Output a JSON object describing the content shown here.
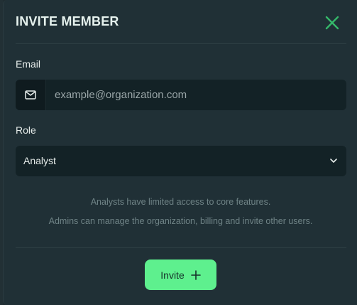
{
  "modal": {
    "title": "INVITE MEMBER",
    "close_icon": "close-icon"
  },
  "email": {
    "label": "Email",
    "placeholder": "example@organization.com",
    "value": "",
    "icon": "mail-icon"
  },
  "role": {
    "label": "Role",
    "selected": "Analyst",
    "icon": "chevron-down-icon"
  },
  "help": {
    "line1": "Analysts have limited access to core features.",
    "line2": "Admins can manage the organization, billing and invite other users."
  },
  "actions": {
    "invite_label": "Invite",
    "invite_icon": "plus-icon"
  },
  "colors": {
    "accent": "#5ef08e",
    "background": "#203036",
    "field": "#132226"
  }
}
